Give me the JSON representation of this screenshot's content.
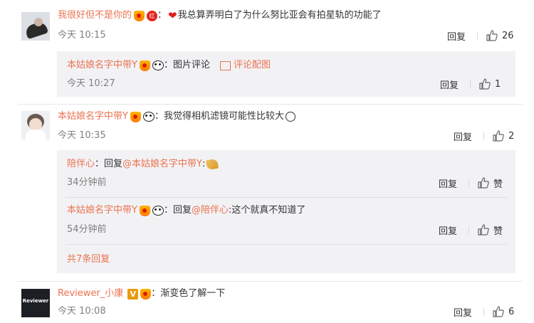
{
  "comments": [
    {
      "user": "我很好但不是你的",
      "text": "我总算弄明白了为什么努比亚会有拍星轨的功能了",
      "time": "今天 10:15",
      "reply_label": "回复",
      "likes": "26",
      "sub_replies": [
        {
          "user": "本姑娘名字中带Y",
          "text": "：图片评论",
          "attachment_label": "评论配图",
          "time": "今天 10:27",
          "reply_label": "回复",
          "likes": "1"
        }
      ]
    },
    {
      "user": "本姑娘名字中带Y",
      "text": "：我觉得相机滤镜可能性比较大",
      "time": "今天 10:35",
      "reply_label": "回复",
      "likes": "2",
      "sub_replies": [
        {
          "user": "陪伴心",
          "prefix": "：回复",
          "mention": "@本姑娘名字中带Y",
          "suffix": ":",
          "time": "34分钟前",
          "reply_label": "回复",
          "likes": "赞"
        },
        {
          "user": "本姑娘名字中带Y",
          "prefix": "：回复",
          "mention": "@陪伴心",
          "suffix": ":这个就真不知道了",
          "time": "54分钟前",
          "reply_label": "回复",
          "likes": "赞"
        }
      ],
      "more_replies": "共7条回复"
    },
    {
      "user": "Reviewer_小康",
      "text": "：渐变色了解一下",
      "time": "今天 10:08",
      "reply_label": "回复",
      "likes": "6",
      "avatar_text": "Reviewer"
    }
  ],
  "badges": {
    "red_circle": "红",
    "vip": "V"
  },
  "colors": {
    "username": "#eb7350",
    "reply_bg": "#f2f2f5",
    "meta": "#808080"
  },
  "icons": [
    "thumb-up-icon",
    "image-icon",
    "medal-icon",
    "panda-icon",
    "heart-icon",
    "emoji-face-icon",
    "clap-emoji-icon",
    "vip-badge-icon"
  ]
}
